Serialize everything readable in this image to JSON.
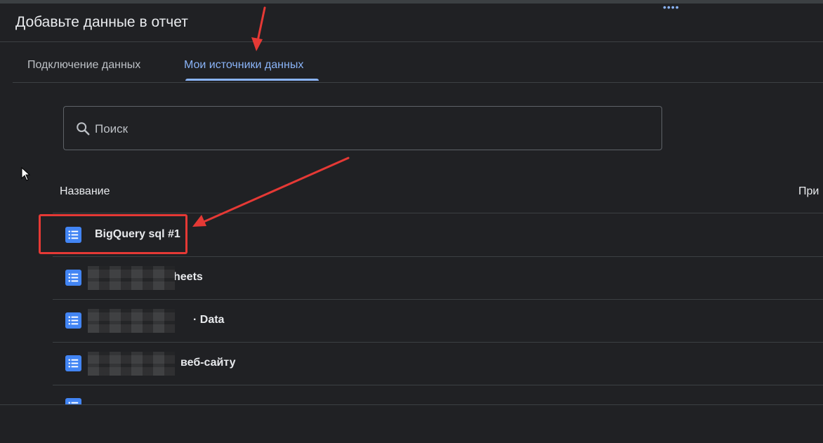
{
  "dialog": {
    "title": "Добавьте данные в отчет"
  },
  "tabs": [
    {
      "label": "Подключение данных",
      "active": false
    },
    {
      "label": "Мои источники данных",
      "active": true
    }
  ],
  "search": {
    "placeholder": "Поиск",
    "icon": "search-icon"
  },
  "table": {
    "columns": [
      "Название",
      "При"
    ],
    "rows": [
      {
        "label": "BigQuery sql #1",
        "icon": "data-source-list-icon",
        "highlighted": true
      },
      {
        "label": "heets",
        "icon": "data-source-list-icon",
        "redacted": true
      },
      {
        "label": "· Data",
        "icon": "data-source-list-icon",
        "redacted": true
      },
      {
        "label": "веб-сайту",
        "icon": "data-source-list-icon",
        "redacted": true
      },
      {
        "label": "",
        "icon": "data-source-list-icon",
        "partially_hidden": true
      }
    ]
  },
  "colors": {
    "background": "#202124",
    "accent": "#8ab4f8",
    "icon_blue": "#4285f4",
    "annotation_red": "#e53935",
    "divider": "#3c4043"
  }
}
